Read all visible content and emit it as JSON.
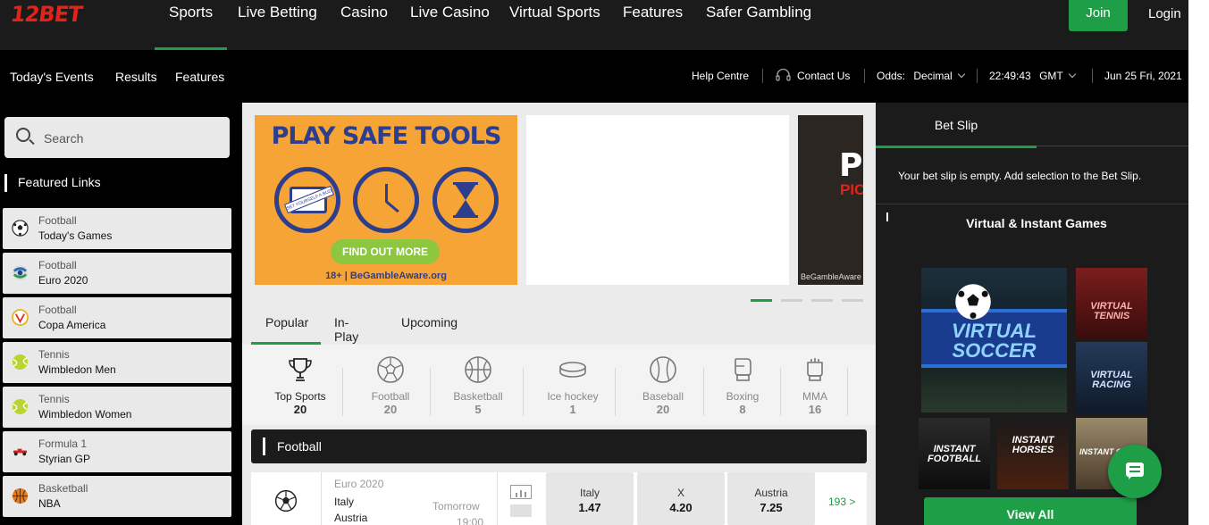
{
  "brand": {
    "logo_text": "12BET",
    "accent": "#1e9e47",
    "logo_color": "#e2231a"
  },
  "topnav": {
    "items": [
      "Sports",
      "Live Betting",
      "Casino",
      "Live Casino",
      "Virtual Sports",
      "Features",
      "Safer Gambling"
    ],
    "active": "Sports",
    "join_label": "Join",
    "login_label": "Login"
  },
  "subnav": {
    "links": [
      "Today's Events",
      "Results",
      "Features"
    ],
    "help": "Help Centre",
    "contact": "Contact Us",
    "odds_label": "Odds:",
    "odds_value": "Decimal",
    "time": "22:49:43",
    "timezone": "GMT",
    "date": "Jun 25 Fri, 2021"
  },
  "sidebar": {
    "search_placeholder": "Search",
    "featured_title": "Featured Links",
    "links": [
      {
        "sport": "Football",
        "name": "Today's Games",
        "icon": "soccer-ball-icon"
      },
      {
        "sport": "Football",
        "name": "Euro 2020",
        "icon": "euro-2020-icon"
      },
      {
        "sport": "Football",
        "name": "Copa America",
        "icon": "copa-america-icon"
      },
      {
        "sport": "Tennis",
        "name": "Wimbledon Men",
        "icon": "tennis-ball-icon"
      },
      {
        "sport": "Tennis",
        "name": "Wimbledon Women",
        "icon": "tennis-ball-icon"
      },
      {
        "sport": "Formula 1",
        "name": "Styrian GP",
        "icon": "race-car-icon"
      },
      {
        "sport": "Basketball",
        "name": "NBA",
        "icon": "basketball-icon"
      }
    ]
  },
  "banner": {
    "title": "PLAY SAFE TOOLS",
    "card_text": "SET YOURSELF A BUDGET",
    "button": "FIND OUT MORE",
    "footer": "18+ | BeGambleAware.org",
    "side_big": "P",
    "side_small": "PIC",
    "side_footer": "BeGambleAware"
  },
  "tabs": [
    "Popular",
    "In-Play",
    "Upcoming"
  ],
  "sports": [
    {
      "name": "Top Sports",
      "count": "20",
      "icon": "trophy-icon"
    },
    {
      "name": "Football",
      "count": "20",
      "icon": "football-icon"
    },
    {
      "name": "Basketball",
      "count": "5",
      "icon": "basketball-icon"
    },
    {
      "name": "Ice hockey",
      "count": "1",
      "icon": "hockey-puck-icon"
    },
    {
      "name": "Baseball",
      "count": "20",
      "icon": "baseball-icon"
    },
    {
      "name": "Boxing",
      "count": "8",
      "icon": "boxing-glove-icon"
    },
    {
      "name": "MMA",
      "count": "16",
      "icon": "mma-glove-icon"
    }
  ],
  "section_title": "Football",
  "match": {
    "competition": "Euro 2020",
    "home": "Italy",
    "away": "Austria",
    "when": "Tomorrow",
    "time": "19:00",
    "odds": [
      {
        "label": "Italy",
        "value": "1.47"
      },
      {
        "label": "X",
        "value": "4.20"
      },
      {
        "label": "Austria",
        "value": "7.25"
      }
    ],
    "more": "193 >"
  },
  "betslip": {
    "tab": "Bet Slip",
    "empty": "Your bet slip is empty. Add selection to the Bet Slip.",
    "games_title": "Virtual & Instant Games",
    "games": [
      "VIRTUAL SOCCER",
      "VIRTUAL TENNIS",
      "VIRTUAL RACING",
      "INSTANT FOOTBALL",
      "INSTANT HORSES",
      "INSTANT GREYHOUNDS"
    ],
    "view_all": "View All"
  }
}
